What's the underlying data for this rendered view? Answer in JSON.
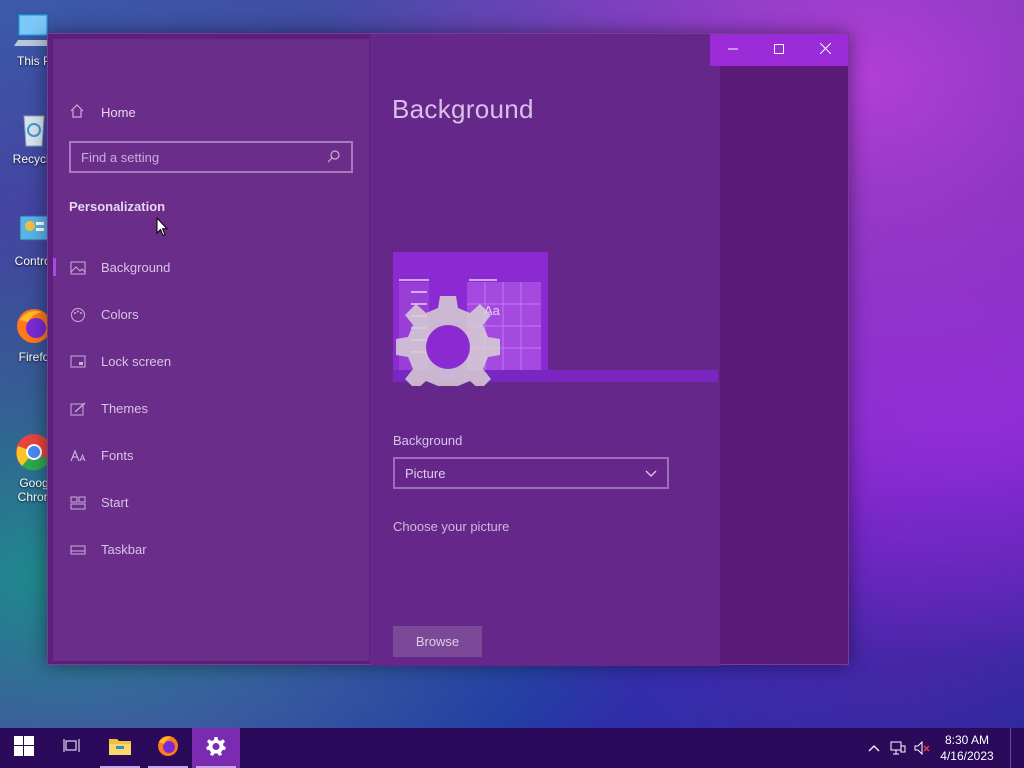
{
  "desktop": {
    "icons": [
      {
        "label": "This P",
        "icon": "pc-icon"
      },
      {
        "label": "Recycle",
        "icon": "recycle-bin-icon"
      },
      {
        "label": "Control",
        "icon": "control-panel-icon"
      },
      {
        "label": "Firefo",
        "icon": "firefox-icon"
      },
      {
        "label": "Goog\nChron",
        "icon": "chrome-icon"
      }
    ]
  },
  "window": {
    "controls": {
      "minimize": "minimize",
      "maximize": "maximize",
      "close": "close"
    }
  },
  "sidebar": {
    "home_label": "Home",
    "search_placeholder": "Find a setting",
    "section_title": "Personalization",
    "items": [
      {
        "label": "Background",
        "icon": "picture-icon",
        "active": true
      },
      {
        "label": "Colors",
        "icon": "palette-icon",
        "active": false
      },
      {
        "label": "Lock screen",
        "icon": "lock-screen-icon",
        "active": false
      },
      {
        "label": "Themes",
        "icon": "brush-icon",
        "active": false
      },
      {
        "label": "Fonts",
        "icon": "font-icon",
        "active": false
      },
      {
        "label": "Start",
        "icon": "start-icon",
        "active": false
      },
      {
        "label": "Taskbar",
        "icon": "taskbar-icon",
        "active": false
      }
    ]
  },
  "main": {
    "title": "Background",
    "preview_sample_text": "Aa",
    "background_label": "Background",
    "background_value": "Picture",
    "choose_label": "Choose your picture",
    "browse_label": "Browse"
  },
  "taskbar": {
    "apps": [
      "start-icon",
      "task-view-icon",
      "file-explorer-icon",
      "firefox-icon",
      "settings-icon"
    ],
    "clock_time": "8:30 AM",
    "clock_date": "4/16/2023"
  },
  "colors": {
    "accent": "#9a2bd6",
    "window_bg": "#5d1f7a",
    "taskbar_bg": "#2b0a5c"
  }
}
